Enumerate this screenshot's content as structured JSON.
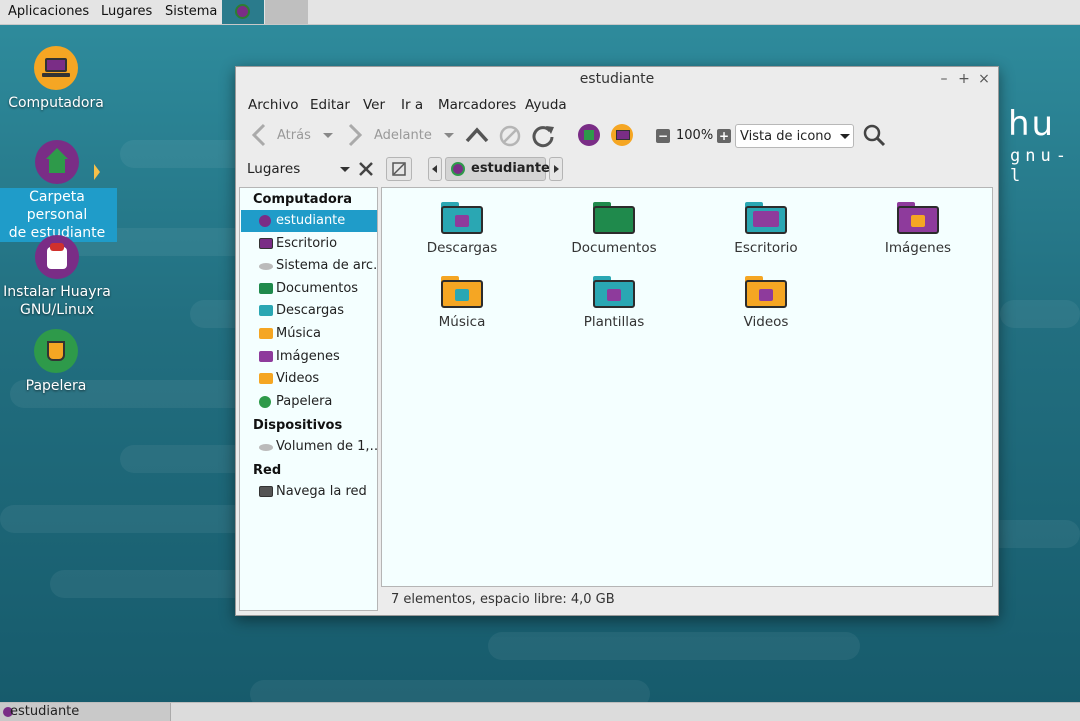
{
  "top_panel": {
    "menus": [
      "Aplicaciones",
      "Lugares",
      "Sistema"
    ]
  },
  "desktop": {
    "icons": [
      {
        "label": "Computadora",
        "icon": "computer-icon",
        "color": "#f5a623"
      },
      {
        "label": "Carpeta personal\nde estudiante",
        "icon": "home-icon",
        "color": "#7a2d86",
        "selected": true
      },
      {
        "label": "Instalar Huayra\nGNU/Linux",
        "icon": "installer-icon",
        "color": "#7a2d86"
      },
      {
        "label": "Papelera",
        "icon": "trash-icon",
        "color": "#2e9a4a"
      }
    ],
    "logo_text": "hu",
    "logo_sub": "gnu-l"
  },
  "window": {
    "title": "estudiante",
    "controls": {
      "minimize": "–",
      "maximize": "+",
      "close": "×"
    },
    "menubar": [
      "Archivo",
      "Editar",
      "Ver",
      "Ir a",
      "Marcadores",
      "Ayuda"
    ],
    "toolbar": {
      "back_label": "Atrás",
      "forward_label": "Adelante",
      "zoom_level": "100%",
      "zoom_out": "−",
      "zoom_in": "+",
      "view_mode": "Vista de icono"
    },
    "sidebar_title": "Lugares",
    "path": {
      "current": "estudiante"
    },
    "sidebar": {
      "sections": [
        {
          "title": "Computadora",
          "items": [
            {
              "label": "estudiante",
              "icon": "home-icon",
              "color": "#7a2d86",
              "selected": true
            },
            {
              "label": "Escritorio",
              "icon": "desktop-icon",
              "color": "#7a2d86"
            },
            {
              "label": "Sistema de arc…",
              "icon": "drive-icon",
              "color": "#bbbbbb"
            },
            {
              "label": "Documentos",
              "icon": "folder-icon",
              "color": "#1f8a4c"
            },
            {
              "label": "Descargas",
              "icon": "folder-icon",
              "color": "#2aa7b3"
            },
            {
              "label": "Música",
              "icon": "folder-icon",
              "color": "#f5a623"
            },
            {
              "label": "Imágenes",
              "icon": "folder-icon",
              "color": "#8e3b9c"
            },
            {
              "label": "Videos",
              "icon": "folder-icon",
              "color": "#f5a623"
            },
            {
              "label": "Papelera",
              "icon": "trash-icon",
              "color": "#2e9a4a"
            }
          ]
        },
        {
          "title": "Dispositivos",
          "items": [
            {
              "label": "Volumen de 1,…",
              "icon": "drive-icon",
              "color": "#bbbbbb"
            }
          ]
        },
        {
          "title": "Red",
          "items": [
            {
              "label": "Navega la red",
              "icon": "network-icon",
              "color": "#555555"
            }
          ]
        }
      ]
    },
    "files": [
      {
        "label": "Descargas",
        "color": "#2aa7b3",
        "emblem": "#8e3b9c"
      },
      {
        "label": "Documentos",
        "color": "#1f8a4c",
        "emblem": "#1f8a4c"
      },
      {
        "label": "Escritorio",
        "color": "#2aa7b3",
        "emblem": "#8e3b9c"
      },
      {
        "label": "Imágenes",
        "color": "#8e3b9c",
        "emblem": "#f5a623"
      },
      {
        "label": "Música",
        "color": "#f5a623",
        "emblem": "#2aa7b3"
      },
      {
        "label": "Plantillas",
        "color": "#2aa7b3",
        "emblem": "#8e3b9c"
      },
      {
        "label": "Videos",
        "color": "#f5a623",
        "emblem": "#8e3b9c"
      }
    ],
    "status": "7 elementos, espacio libre: 4,0 GB"
  },
  "taskbar": {
    "task_label": "estudiante"
  },
  "colors": {
    "selection": "#1f9cc9",
    "desktop_bg": "#226f80"
  }
}
